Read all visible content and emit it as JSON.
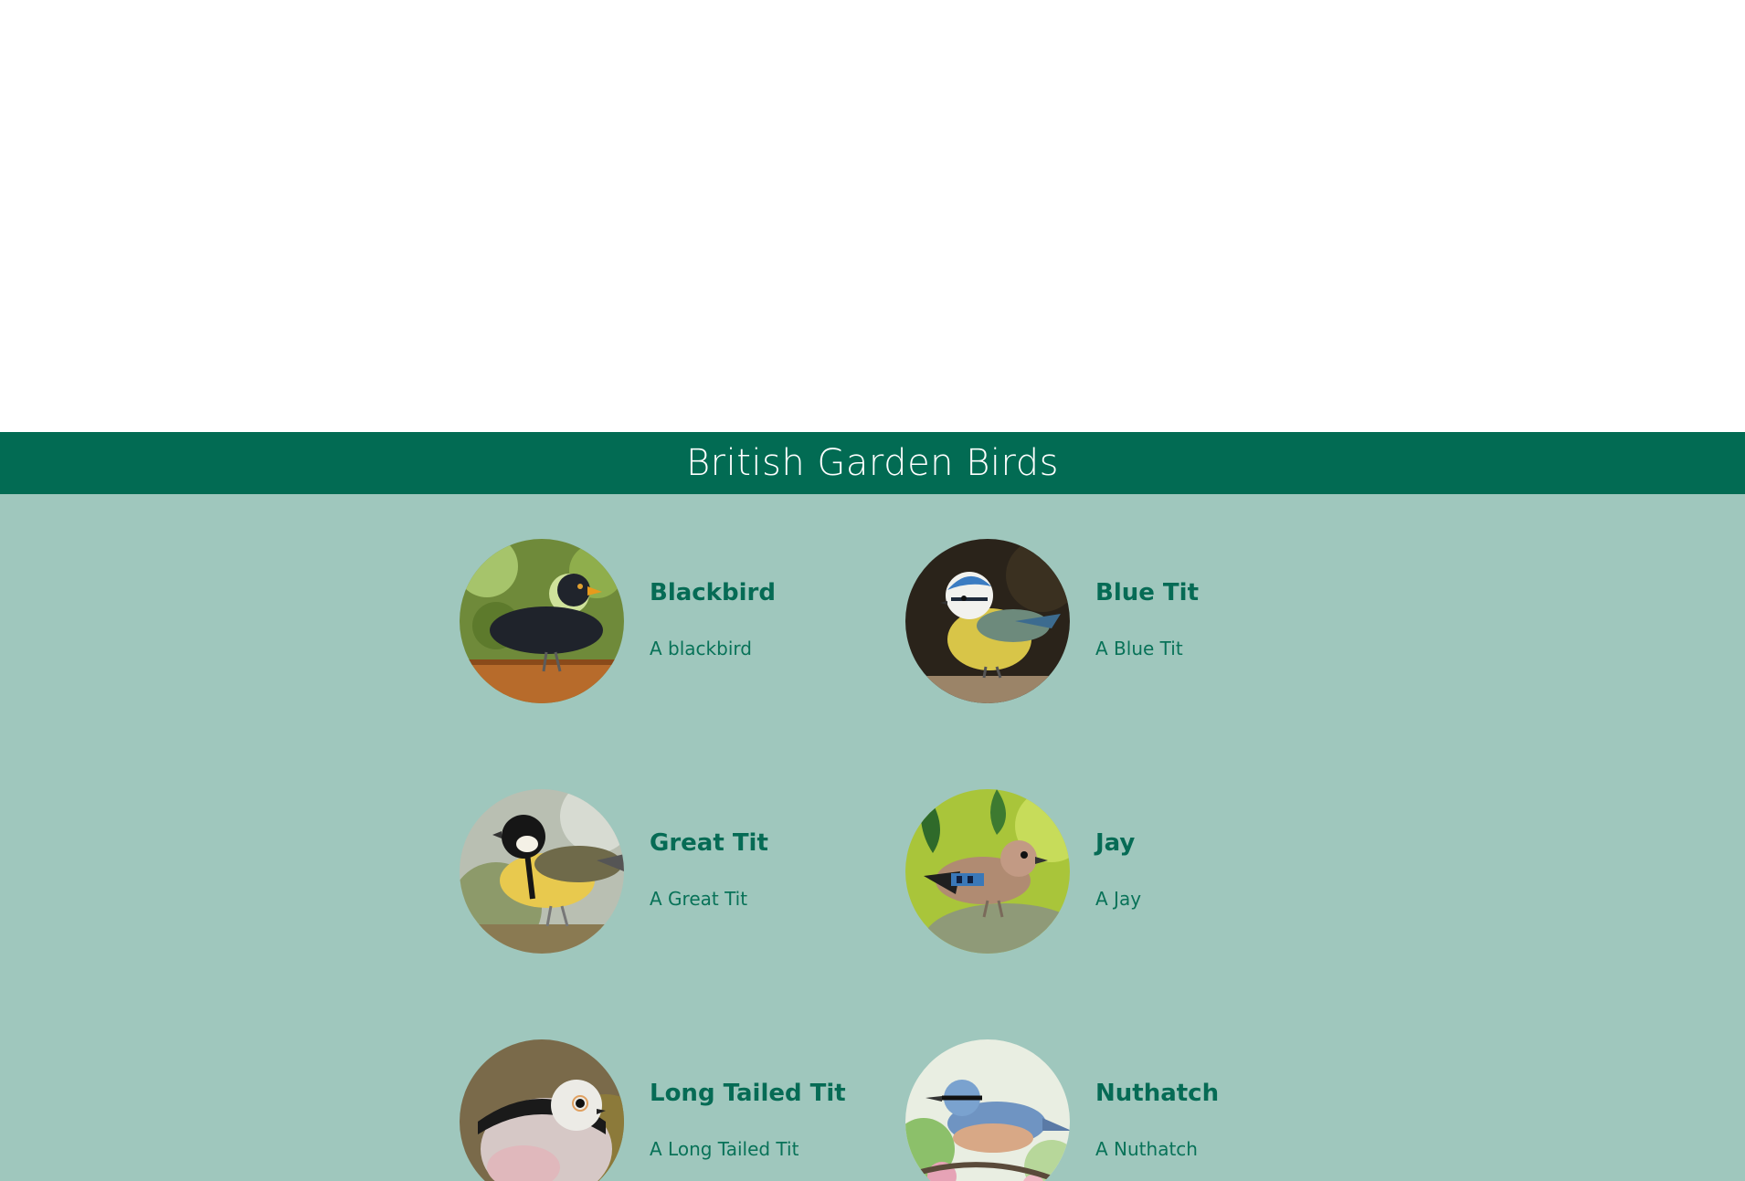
{
  "header": {
    "title": "British Garden Birds"
  },
  "birds": [
    {
      "name": "Blackbird",
      "description": "A blackbird",
      "icon": "blackbird-photo"
    },
    {
      "name": "Blue Tit",
      "description": "A Blue Tit",
      "icon": "blue-tit-photo"
    },
    {
      "name": "Great Tit",
      "description": "A Great Tit",
      "icon": "great-tit-photo"
    },
    {
      "name": "Jay",
      "description": "A Jay",
      "icon": "jay-photo"
    },
    {
      "name": "Long Tailed Tit",
      "description": "A Long Tailed Tit",
      "icon": "long-tailed-tit-photo"
    },
    {
      "name": "Nuthatch",
      "description": "A Nuthatch",
      "icon": "nuthatch-photo"
    }
  ],
  "colors": {
    "header_bg": "#026b53",
    "content_bg": "#9fc7bd",
    "title_text": "#066b55",
    "desc_text": "#087258"
  }
}
